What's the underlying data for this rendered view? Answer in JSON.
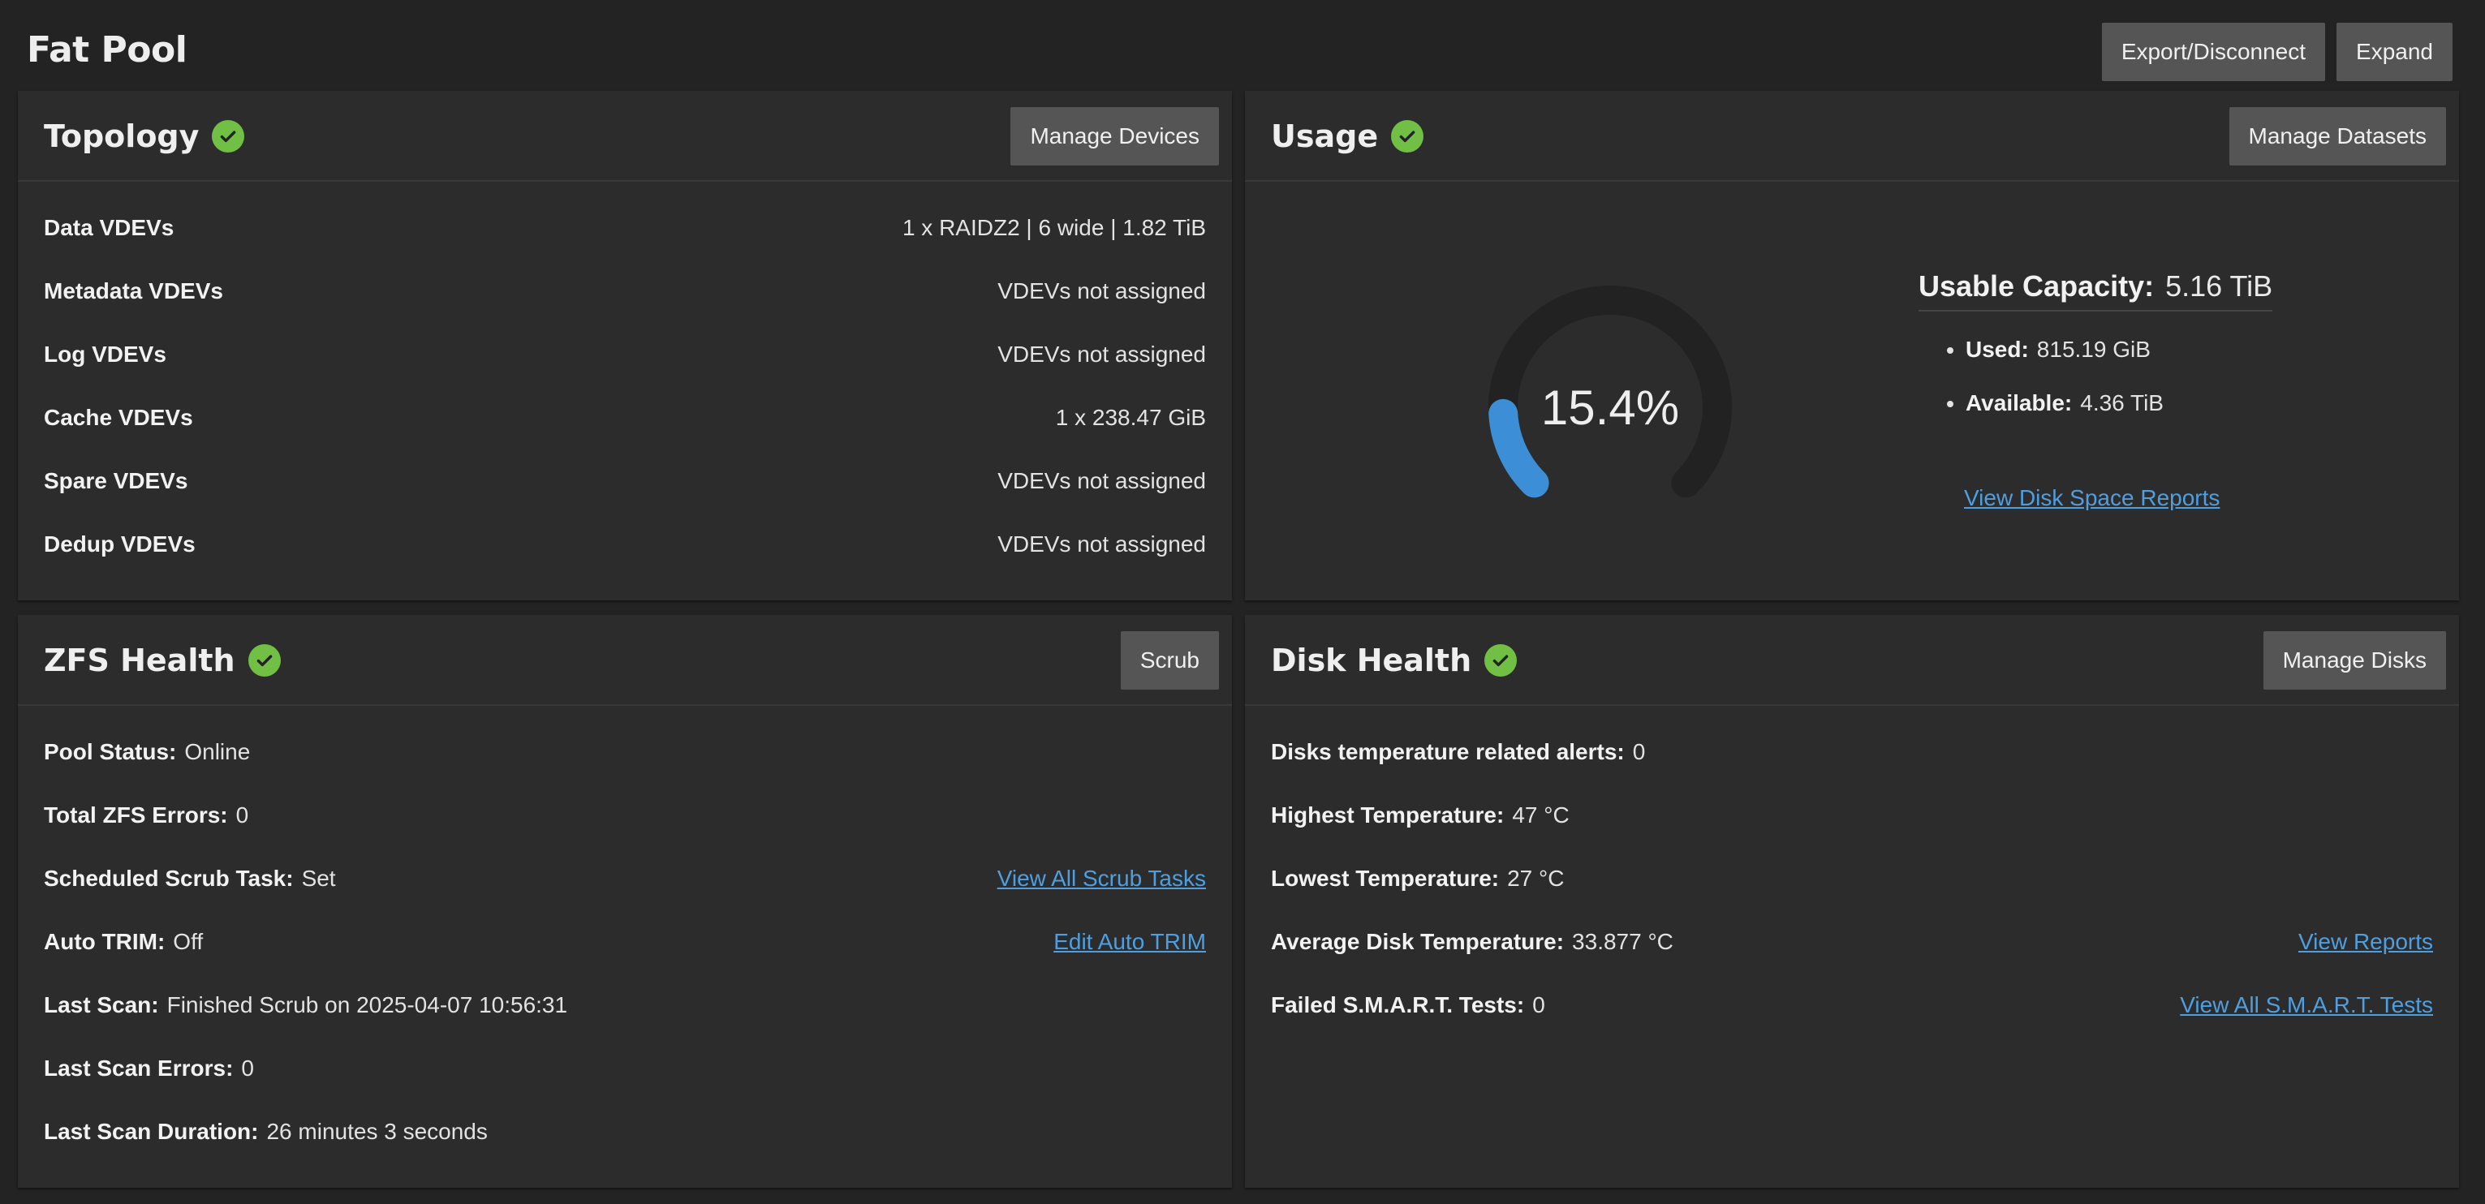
{
  "page": {
    "title": "Fat Pool",
    "actions": {
      "export_label": "Export/Disconnect",
      "expand_label": "Expand"
    }
  },
  "colors": {
    "accent": "#4f9fe0",
    "success": "#71bf44",
    "gauge_track": "#222222",
    "gauge_fill": "#3c8fd6"
  },
  "topology": {
    "title": "Topology",
    "status_icon": "check-circle-icon",
    "button": "Manage Devices",
    "rows": [
      {
        "label": "Data VDEVs",
        "value": "1 x RAIDZ2 | 6 wide | 1.82 TiB"
      },
      {
        "label": "Metadata VDEVs",
        "value": "VDEVs not assigned"
      },
      {
        "label": "Log VDEVs",
        "value": "VDEVs not assigned"
      },
      {
        "label": "Cache VDEVs",
        "value": "1 x 238.47 GiB"
      },
      {
        "label": "Spare VDEVs",
        "value": "VDEVs not assigned"
      },
      {
        "label": "Dedup VDEVs",
        "value": "VDEVs not assigned"
      }
    ]
  },
  "usage": {
    "title": "Usage",
    "status_icon": "check-circle-icon",
    "button": "Manage Datasets",
    "gauge_text": "15.4%",
    "gauge_fraction": 0.154,
    "capacity_label": "Usable Capacity:",
    "capacity_value": "5.16 TiB",
    "used_label": "Used:",
    "used_value": "815.19 GiB",
    "available_label": "Available:",
    "available_value": "4.36 TiB",
    "link": "View Disk Space Reports"
  },
  "zfs_health": {
    "title": "ZFS Health",
    "status_icon": "check-circle-icon",
    "button": "Scrub",
    "rows": [
      {
        "label": "Pool Status:",
        "value": "Online",
        "link": ""
      },
      {
        "label": "Total ZFS Errors:",
        "value": "0",
        "link": ""
      },
      {
        "label": "Scheduled Scrub Task:",
        "value": "Set",
        "link": "View All Scrub Tasks"
      },
      {
        "label": "Auto TRIM:",
        "value": "Off",
        "link": "Edit Auto TRIM"
      },
      {
        "label": "Last Scan:",
        "value": "Finished Scrub on 2025-04-07 10:56:31",
        "link": ""
      },
      {
        "label": "Last Scan Errors:",
        "value": "0",
        "link": ""
      },
      {
        "label": "Last Scan Duration:",
        "value": "26 minutes 3 seconds",
        "link": ""
      }
    ]
  },
  "disk_health": {
    "title": "Disk Health",
    "status_icon": "check-circle-icon",
    "button": "Manage Disks",
    "rows": [
      {
        "label": "Disks temperature related alerts:",
        "value": "0",
        "link": ""
      },
      {
        "label": "Highest Temperature:",
        "value": "47 °C",
        "link": ""
      },
      {
        "label": "Lowest Temperature:",
        "value": "27 °C",
        "link": ""
      },
      {
        "label": "Average Disk Temperature:",
        "value": "33.877 °C",
        "link": "View Reports"
      },
      {
        "label": "Failed S.M.A.R.T. Tests:",
        "value": "0",
        "link": "View All S.M.A.R.T. Tests"
      }
    ]
  }
}
